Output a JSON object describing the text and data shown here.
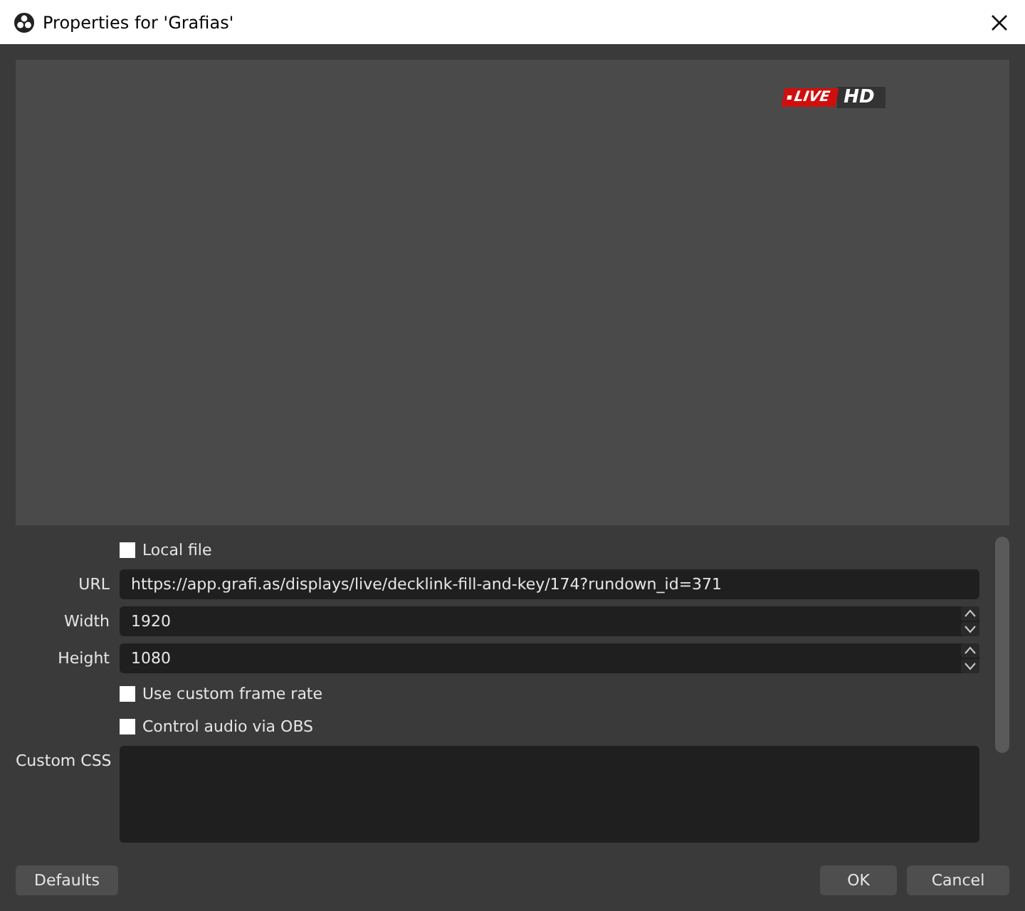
{
  "window": {
    "title": "Properties for 'Grafias'"
  },
  "preview": {
    "badge": {
      "live": "LIVE",
      "hd": "HD"
    }
  },
  "properties": [
    {
      "kind": "checkbox",
      "label": "Local file",
      "checked": false
    },
    {
      "kind": "text",
      "label": "URL",
      "value": "https://app.grafi.as/displays/live/decklink-fill-and-key/174?rundown_id=371"
    },
    {
      "kind": "spin",
      "label": "Width",
      "value": "1920"
    },
    {
      "kind": "spin",
      "label": "Height",
      "value": "1080"
    },
    {
      "kind": "checkbox",
      "label": "Use custom frame rate",
      "checked": false
    },
    {
      "kind": "checkbox",
      "label": "Control audio via OBS",
      "checked": false
    },
    {
      "kind": "textarea",
      "label": "Custom CSS"
    }
  ],
  "buttons": {
    "left": [
      "Defaults"
    ],
    "right": [
      "OK",
      "Cancel"
    ]
  }
}
